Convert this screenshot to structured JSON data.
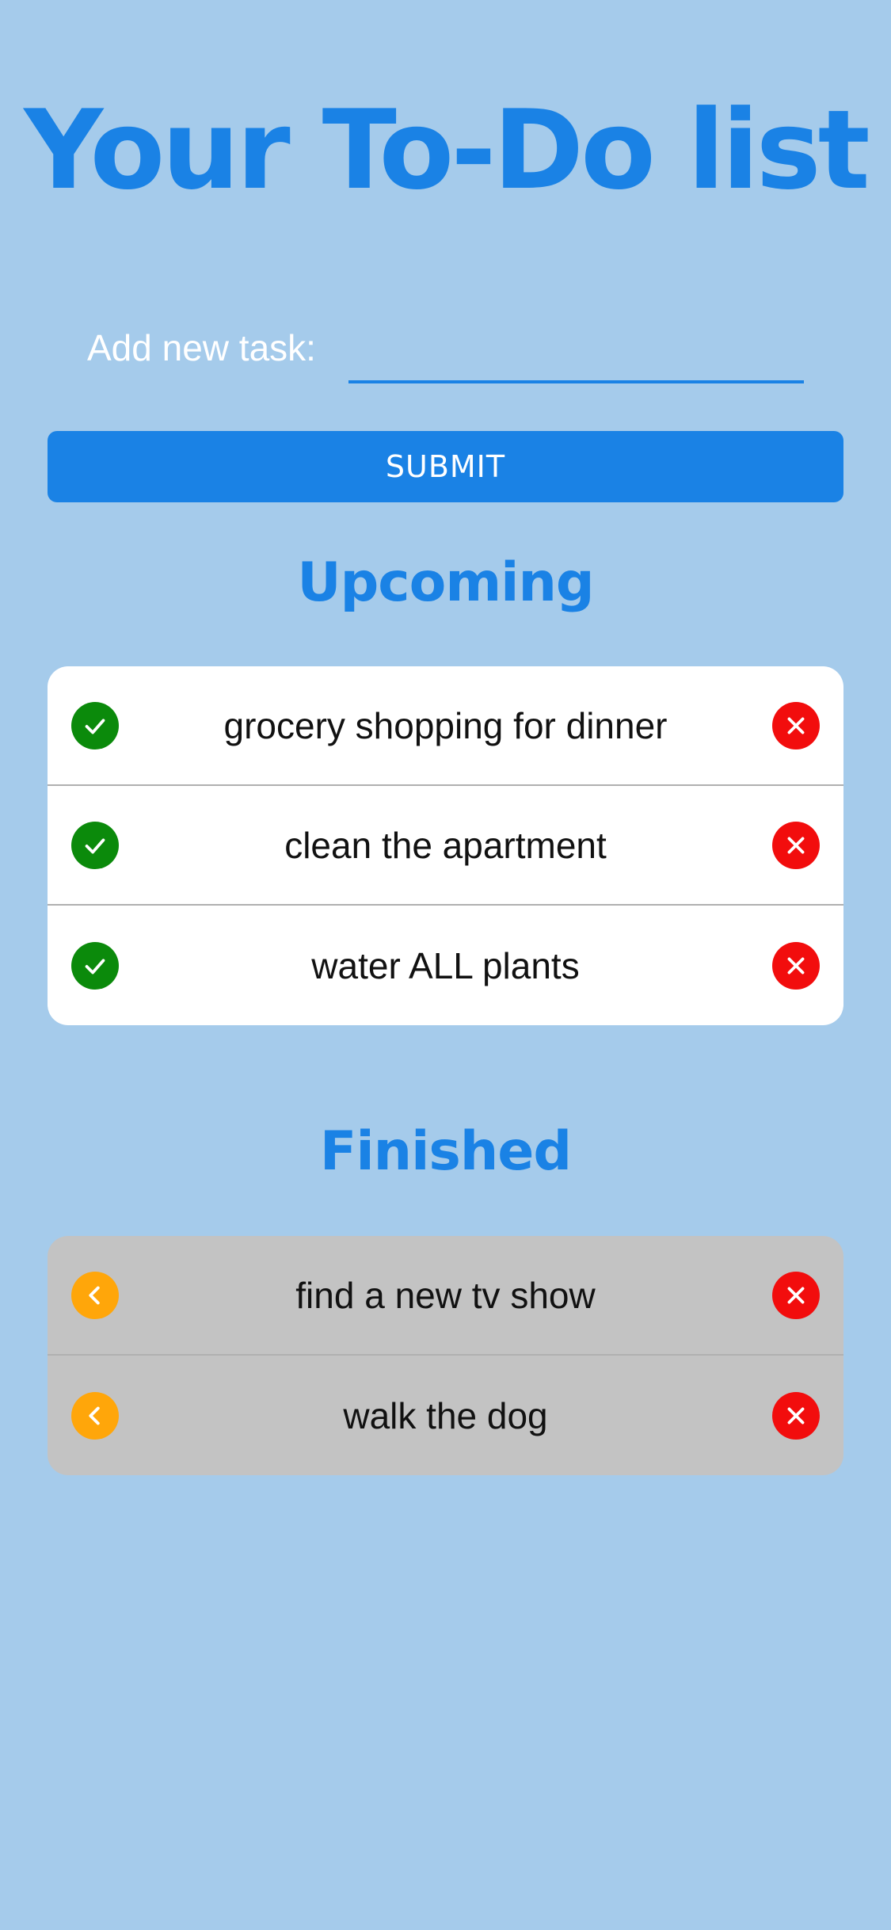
{
  "app": {
    "title": "Your To-Do list"
  },
  "add_task": {
    "label": "Add new task:",
    "value": "",
    "placeholder": "",
    "submit_label": "SUBMIT"
  },
  "upcoming": {
    "heading": "Upcoming",
    "items": [
      {
        "text": "grocery shopping for dinner"
      },
      {
        "text": "clean the apartment"
      },
      {
        "text": "water ALL plants"
      }
    ]
  },
  "finished": {
    "heading": "Finished",
    "items": [
      {
        "text": "find a new tv show"
      },
      {
        "text": "walk the dog"
      }
    ]
  },
  "icons": {
    "complete": "check-icon",
    "delete": "close-icon",
    "restore": "chevron-left-icon"
  },
  "colors": {
    "background": "#a5cbeb",
    "accent": "#1a82e5",
    "complete": "#0b8a0b",
    "delete": "#f20d0d",
    "restore": "#ffa60a",
    "upcoming_card": "#ffffff",
    "finished_card": "#c3c3c3"
  }
}
